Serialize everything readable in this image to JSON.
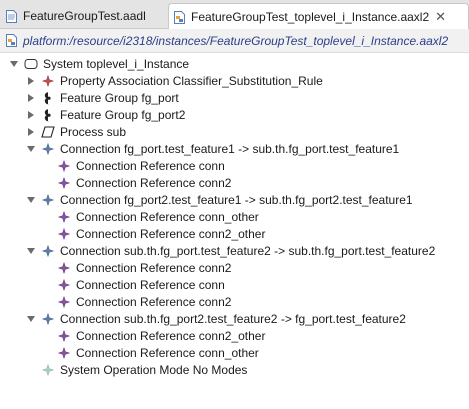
{
  "tabs": [
    {
      "label": "FeatureGroupTest.aadl",
      "active": false
    },
    {
      "label": "FeatureGroupTest_toplevel_i_Instance.aaxl2",
      "active": true,
      "close": "✕"
    }
  ],
  "address": {
    "path": "platform:/resource/i2318/instances/FeatureGroupTest_toplevel_i_Instance.aaxl2"
  },
  "tree": {
    "root": {
      "label": "System toplevel_i_Instance",
      "icon": "system-icon",
      "expanded": true
    },
    "items": [
      {
        "label": "Property Association Classifier_Substitution_Rule",
        "icon": "property-association-icon",
        "twisty": "collapsed"
      },
      {
        "label": "Feature Group fg_port",
        "icon": "feature-group-icon",
        "twisty": "collapsed"
      },
      {
        "label": "Feature Group fg_port2",
        "icon": "feature-group-icon",
        "twisty": "collapsed"
      },
      {
        "label": "Process sub",
        "icon": "process-icon",
        "twisty": "collapsed"
      },
      {
        "label": "Connection fg_port.test_feature1 -> sub.th.fg_port.test_feature1",
        "icon": "connection-icon",
        "twisty": "expanded",
        "children": [
          "Connection Reference conn",
          "Connection Reference conn2"
        ]
      },
      {
        "label": "Connection fg_port2.test_feature1 -> sub.th.fg_port2.test_feature1",
        "icon": "connection-icon",
        "twisty": "expanded",
        "children": [
          "Connection Reference conn_other",
          "Connection Reference conn2_other"
        ]
      },
      {
        "label": "Connection sub.th.fg_port.test_feature2 -> sub.th.fg_port.test_feature2",
        "icon": "connection-icon",
        "twisty": "expanded",
        "children": [
          "Connection Reference conn2",
          "Connection Reference conn",
          "Connection Reference conn2"
        ]
      },
      {
        "label": "Connection sub.th.fg_port2.test_feature2 -> fg_port.test_feature2",
        "icon": "connection-icon",
        "twisty": "expanded",
        "children": [
          "Connection Reference conn2_other",
          "Connection Reference conn_other"
        ]
      },
      {
        "label": "System Operation Mode No Modes",
        "icon": "mode-icon",
        "twisty": "none"
      }
    ]
  },
  "colors": {
    "connection": "#5c7fb0",
    "connection_reference": "#8b4fa8",
    "property": "#c0504d",
    "mode": "#7fb3a8"
  }
}
